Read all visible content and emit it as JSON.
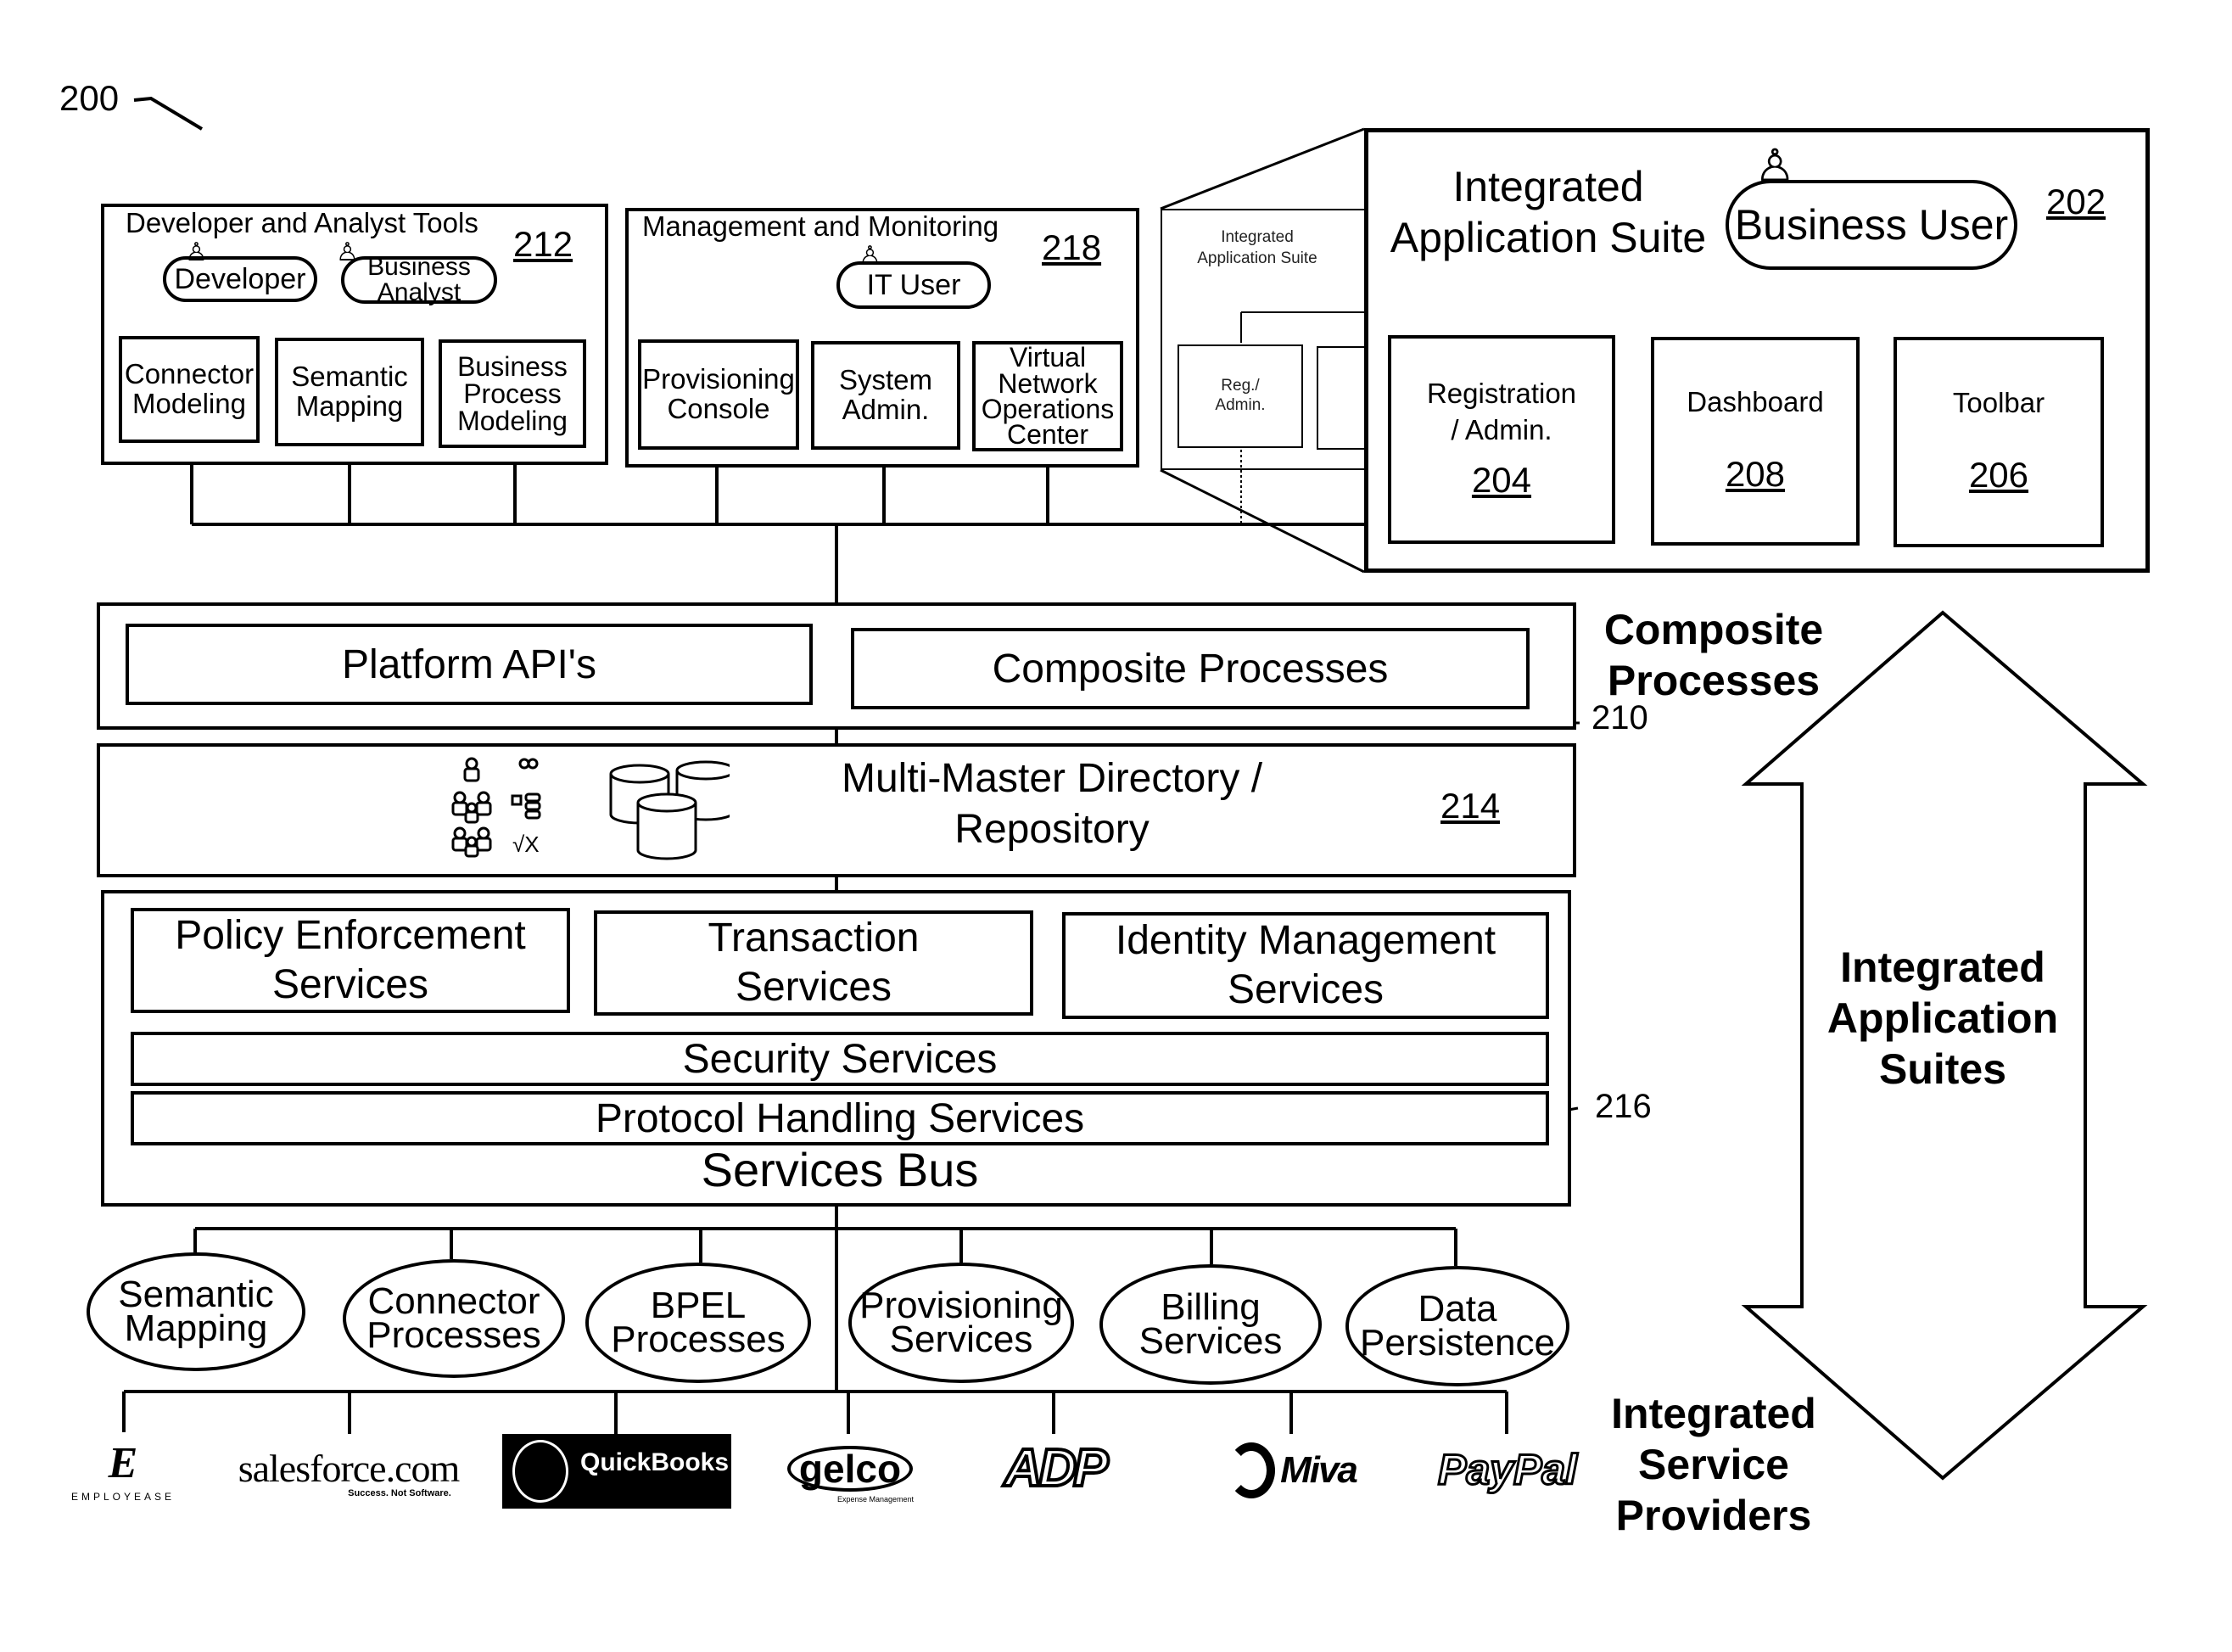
{
  "figure": {
    "ref_label": "200"
  },
  "developer_tools": {
    "title": "Developer and Analyst Tools",
    "ref": "212",
    "users": [
      "Developer",
      "Business Analyst"
    ],
    "users_lines": {
      "developer": "Developer",
      "analyst_1": "Business",
      "analyst_2": "Analyst"
    },
    "tools": [
      {
        "line1": "Connector",
        "line2": "Modeling",
        "line3": ""
      },
      {
        "line1": "Semantic",
        "line2": "Mapping",
        "line3": ""
      },
      {
        "line1": "Business",
        "line2": "Process",
        "line3": "Modeling"
      }
    ]
  },
  "management": {
    "title": "Management and Monitoring",
    "ref": "218",
    "user": "IT User",
    "tools": [
      {
        "line1": "Provisioning",
        "line2": "Console",
        "line3": "",
        "line4": ""
      },
      {
        "line1": "System",
        "line2": "Admin.",
        "line3": "",
        "line4": ""
      },
      {
        "line1": "Virtual",
        "line2": "Network",
        "line3": "Operations",
        "line4": "Center"
      }
    ]
  },
  "suite_ghost": {
    "title_line1": "Integrated",
    "title_line2": "Application Suite",
    "item_line1": "Reg./",
    "item_line2": "Admin."
  },
  "suite": {
    "title_line1": "Integrated",
    "title_line2": "Application Suite",
    "user": "Business User",
    "ref": "202",
    "items": [
      {
        "line1": "Registration",
        "line2": "/ Admin.",
        "ref": "204"
      },
      {
        "line1": "Dashboard",
        "line2": "",
        "ref": "208"
      },
      {
        "line1": "Toolbar",
        "line2": "",
        "ref": "206"
      }
    ]
  },
  "composite": {
    "platform_api": "Platform API's",
    "composite_processes": "Composite Processes",
    "side_label_line1": "Composite",
    "side_label_line2": "Processes",
    "ref": "210"
  },
  "repository": {
    "title_line1": "Multi-Master Directory /",
    "title_line2": "Repository",
    "ref": "214",
    "icons": [
      "user-icon",
      "link-icon",
      "group-icon",
      "hierarchy-icon",
      "group-icon",
      "check-x-icon",
      "database-icon"
    ],
    "check_x_text": "√X"
  },
  "services_bus": {
    "top_services": [
      {
        "line1": "Policy Enforcement",
        "line2": "Services"
      },
      {
        "line1": "Transaction",
        "line2": "Services"
      },
      {
        "line1": "Identity Management",
        "line2": "Services"
      }
    ],
    "security": "Security Services",
    "protocol": "Protocol Handling Services",
    "title": "Services Bus",
    "ref": "216"
  },
  "service_nodes": [
    {
      "line1": "Semantic",
      "line2": "Mapping"
    },
    {
      "line1": "Connector",
      "line2": "Processes"
    },
    {
      "line1": "BPEL",
      "line2": "Processes"
    },
    {
      "line1": "Provisioning",
      "line2": "Services"
    },
    {
      "line1": "Billing",
      "line2": "Services"
    },
    {
      "line1": "Data",
      "line2": "Persistence"
    }
  ],
  "providers": {
    "label_line1": "Integrated",
    "label_line2": "Service",
    "label_line3": "Providers",
    "logos": [
      {
        "name": "Employease",
        "mark": "E",
        "sub": "EMPLOYEASE"
      },
      {
        "name": "salesforce.com",
        "mark": "salesforce.com",
        "sub": "Success. Not Software."
      },
      {
        "name": "QuickBooks",
        "mark": "QuickBooks",
        "sub": ""
      },
      {
        "name": "Gelco",
        "mark": "gelco",
        "sub": "Expense Management"
      },
      {
        "name": "ADP",
        "mark": "ADP",
        "sub": ""
      },
      {
        "name": "Miva",
        "mark": "Miva",
        "sub": ""
      },
      {
        "name": "PayPal",
        "mark": "PayPal",
        "sub": ""
      }
    ]
  },
  "arrow": {
    "label_line1": "Integrated",
    "label_line2": "Application",
    "label_line3": "Suites"
  }
}
